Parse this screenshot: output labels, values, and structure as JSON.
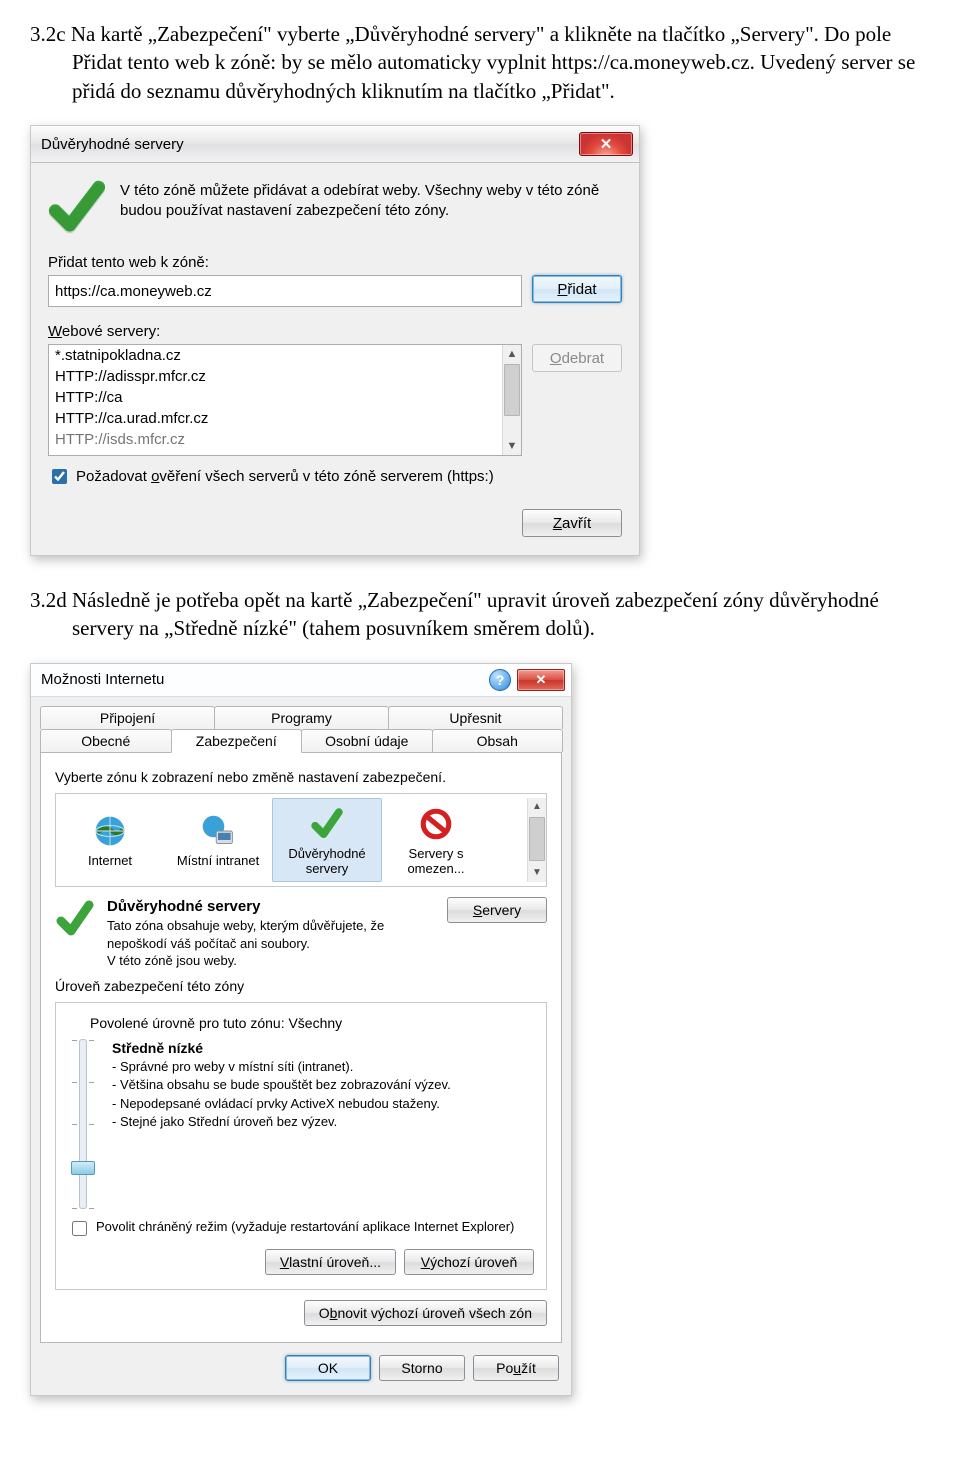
{
  "instruction1": "3.2c Na kartě „Zabezpečení\" vyberte „Důvěryhodné servery\" a klikněte na tlačítko „Servery\". Do pole Přidat tento web k zóně: by se mělo automaticky vyplnit https://ca.moneyweb.cz. Uvedený server se přidá do seznamu důvěryhodných kliknutím na tlačítko „Přidat\".",
  "instruction2": "3.2d Následně je potřeba opět na kartě „Zabezpečení\" upravit úroveň zabezpečení zóny důvěryhodné servery na „Středně nízké\" (tahem posuvníkem směrem dolů).",
  "dialog1": {
    "title": "Důvěryhodné servery",
    "close_x": "✕",
    "desc": "V této zóně můžete přidávat a odebírat weby. Všechny weby v této zóně budou používat nastavení zabezpečení této zóny.",
    "add_label": "Přidat tento web k zóně:",
    "add_value": "https://ca.moneyweb.cz",
    "add_btn": "Přidat",
    "servers_label": "Webové servery:",
    "items": [
      "*.statnipokladna.cz",
      "HTTP://adisspr.mfcr.cz",
      "HTTP://ca",
      "HTTP://ca.urad.mfcr.cz",
      "HTTP://isds.mfcr.cz"
    ],
    "remove_btn": "Odebrat",
    "require_label_pre": "Požadovat ",
    "require_label_u": "o",
    "require_label_post": "věření všech serverů v této zóně serverem (https:)",
    "close_btn": "Zavřít"
  },
  "dialog2": {
    "title": "Možnosti Internetu",
    "help": "?",
    "close": "✕",
    "tabs_top": [
      "Připojení",
      "Programy",
      "Upřesnit"
    ],
    "tabs_bottom": [
      "Obecné",
      "Zabezpečení",
      "Osobní údaje",
      "Obsah"
    ],
    "section_select": "Vyberte zónu k zobrazení nebo změně nastavení zabezpečení.",
    "zones": [
      {
        "name": "Internet"
      },
      {
        "name": "Místní intranet"
      },
      {
        "name": "Důvěryhodné servery",
        "selected": true
      },
      {
        "name": "Servery s omezen..."
      }
    ],
    "zone_title": "Důvěryhodné servery",
    "zone_desc": "Tato zóna obsahuje weby, kterým důvěřujete, že nepoškodí váš počítač ani soubory.\nV této zóně jsou weby.",
    "servers_btn": "Servery",
    "level_label": "Úroveň zabezpečení této zóny",
    "allowed": "Povolené úrovně pro tuto zónu: Všechny",
    "level_name": "Středně nízké",
    "level_points": [
      "- Správné pro weby v místní síti (intranet).",
      "- Většina obsahu se bude spouštět bez zobrazování výzev.",
      "- Nepodepsané ovládací prvky ActiveX nebudou staženy.",
      "- Stejné jako Střední úroveň bez výzev."
    ],
    "chk_protected": "Povolit chráněný režim (vyžaduje restartování aplikace Internet Explorer)",
    "btn_custom": "Vlastní úroveň...",
    "btn_default": "Výchozí úroveň",
    "btn_reset": "Obnovit výchozí úroveň všech zón",
    "ok": "OK",
    "cancel": "Storno",
    "apply": "Použít",
    "underline_chars": {
      "custom": "V",
      "default": "V",
      "reset": "b",
      "servers": "S",
      "apply": "u",
      "close": "Z",
      "add": "P",
      "remove": "O"
    }
  }
}
